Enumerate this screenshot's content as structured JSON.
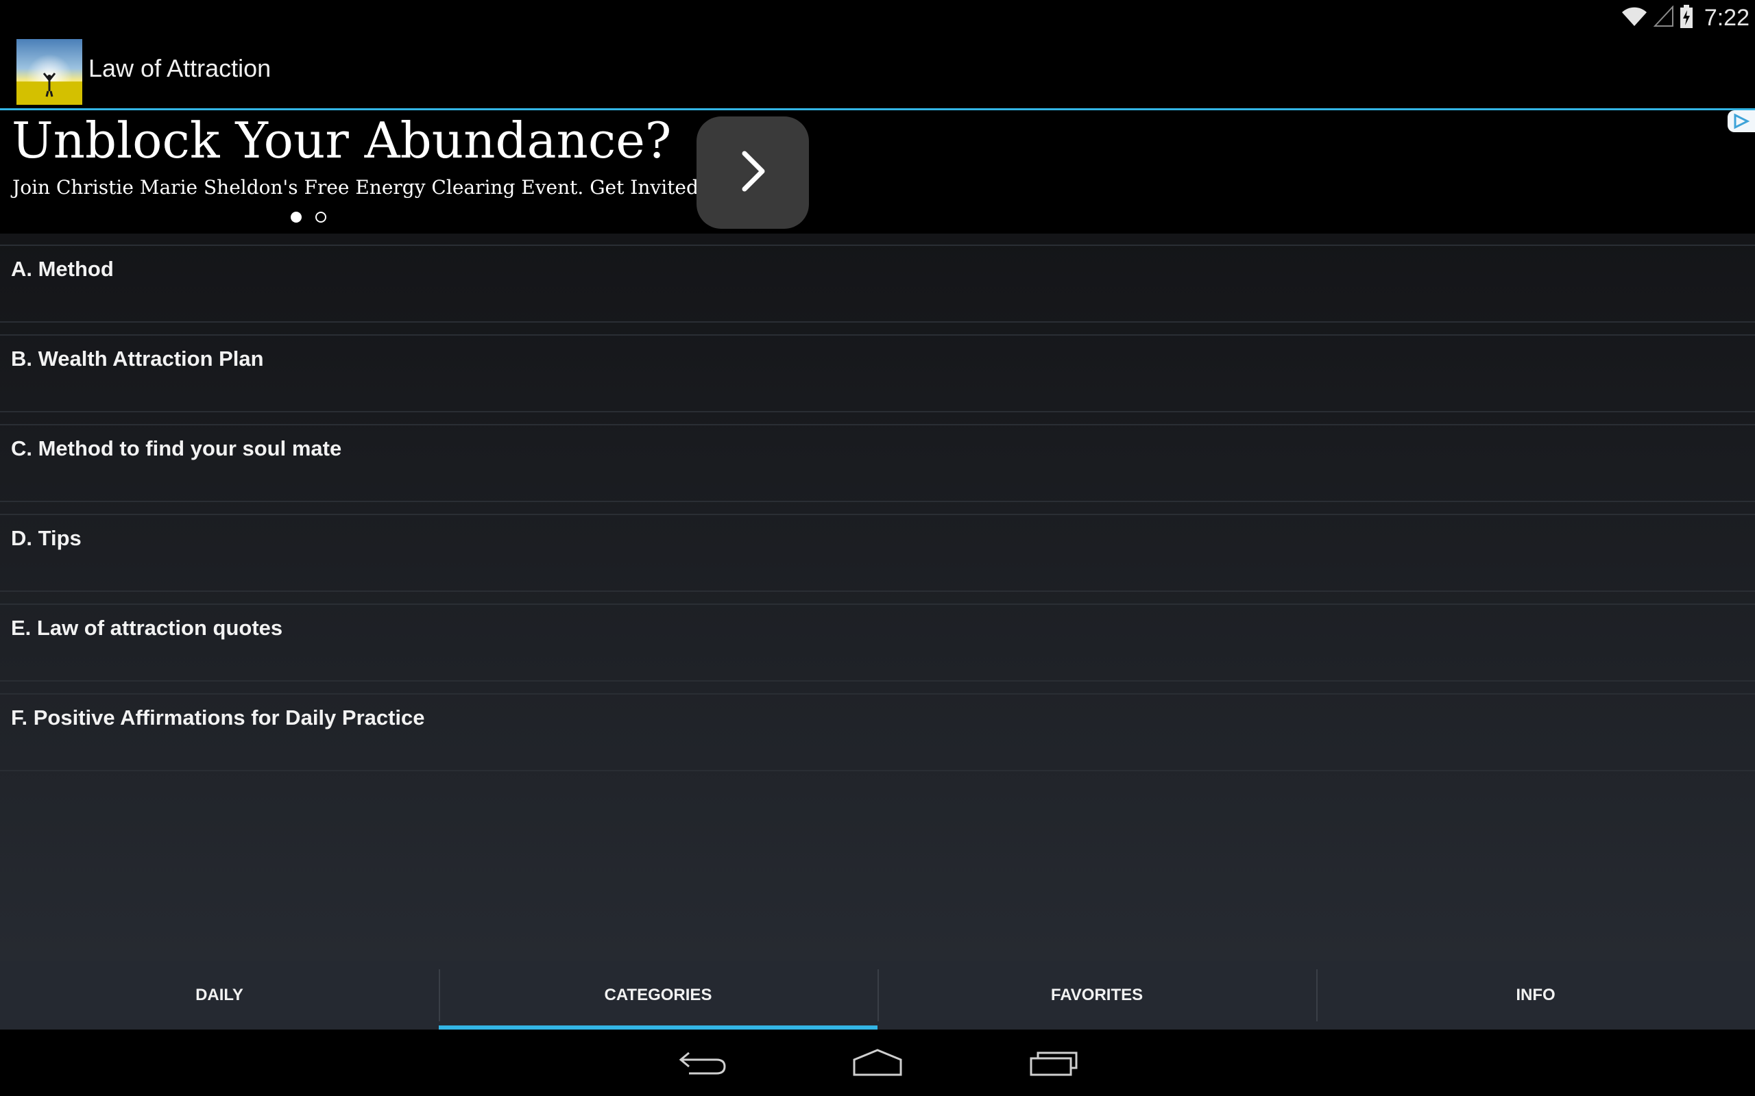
{
  "status_bar": {
    "time": "7:22",
    "icons": [
      "wifi-icon",
      "signal-icon",
      "battery-charging-icon"
    ]
  },
  "action_bar": {
    "title": "Law of Attraction",
    "logo": "app-logo-sunrise-image"
  },
  "ad": {
    "headline": "Unblock Your Abundance?",
    "body": "Join Christie Marie Sheldon's Free Energy Clearing Event. Get Invited!",
    "arrow_icon": "chevron-right-icon",
    "choices_icon": "ad-choices-icon",
    "carousel_pages": 2,
    "carousel_active": 1
  },
  "categories": [
    {
      "label": "A. Method"
    },
    {
      "label": "B. Wealth Attraction Plan"
    },
    {
      "label": "C. Method to find your soul mate"
    },
    {
      "label": "D. Tips"
    },
    {
      "label": "E. Law of attraction quotes"
    },
    {
      "label": "F. Positive Affirmations for Daily Practice"
    }
  ],
  "tabs": [
    {
      "label": "DAILY",
      "active": false
    },
    {
      "label": "CATEGORIES",
      "active": true
    },
    {
      "label": "FAVORITES",
      "active": false
    },
    {
      "label": "INFO",
      "active": false
    }
  ],
  "nav_bar": {
    "buttons": [
      "back-icon",
      "home-icon",
      "recent-apps-icon"
    ]
  },
  "colors": {
    "accent": "#33b5e5",
    "tab_background": "#252931",
    "ad_button": "#3a3a3a"
  }
}
